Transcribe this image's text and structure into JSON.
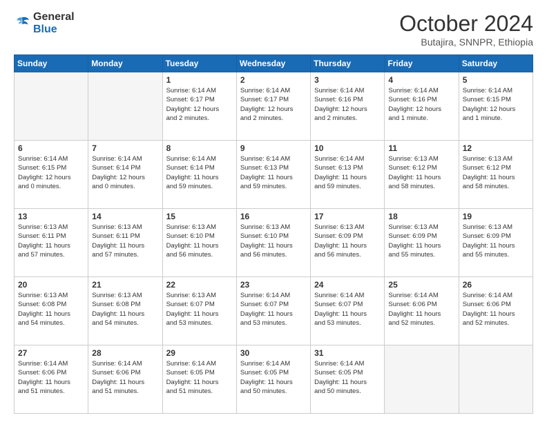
{
  "header": {
    "logo_general": "General",
    "logo_blue": "Blue",
    "title": "October 2024",
    "location": "Butajira, SNNPR, Ethiopia"
  },
  "days_of_week": [
    "Sunday",
    "Monday",
    "Tuesday",
    "Wednesday",
    "Thursday",
    "Friday",
    "Saturday"
  ],
  "weeks": [
    [
      {
        "day": "",
        "info": ""
      },
      {
        "day": "",
        "info": ""
      },
      {
        "day": "1",
        "info": "Sunrise: 6:14 AM\nSunset: 6:17 PM\nDaylight: 12 hours\nand 2 minutes."
      },
      {
        "day": "2",
        "info": "Sunrise: 6:14 AM\nSunset: 6:17 PM\nDaylight: 12 hours\nand 2 minutes."
      },
      {
        "day": "3",
        "info": "Sunrise: 6:14 AM\nSunset: 6:16 PM\nDaylight: 12 hours\nand 2 minutes."
      },
      {
        "day": "4",
        "info": "Sunrise: 6:14 AM\nSunset: 6:16 PM\nDaylight: 12 hours\nand 1 minute."
      },
      {
        "day": "5",
        "info": "Sunrise: 6:14 AM\nSunset: 6:15 PM\nDaylight: 12 hours\nand 1 minute."
      }
    ],
    [
      {
        "day": "6",
        "info": "Sunrise: 6:14 AM\nSunset: 6:15 PM\nDaylight: 12 hours\nand 0 minutes."
      },
      {
        "day": "7",
        "info": "Sunrise: 6:14 AM\nSunset: 6:14 PM\nDaylight: 12 hours\nand 0 minutes."
      },
      {
        "day": "8",
        "info": "Sunrise: 6:14 AM\nSunset: 6:14 PM\nDaylight: 11 hours\nand 59 minutes."
      },
      {
        "day": "9",
        "info": "Sunrise: 6:14 AM\nSunset: 6:13 PM\nDaylight: 11 hours\nand 59 minutes."
      },
      {
        "day": "10",
        "info": "Sunrise: 6:14 AM\nSunset: 6:13 PM\nDaylight: 11 hours\nand 59 minutes."
      },
      {
        "day": "11",
        "info": "Sunrise: 6:13 AM\nSunset: 6:12 PM\nDaylight: 11 hours\nand 58 minutes."
      },
      {
        "day": "12",
        "info": "Sunrise: 6:13 AM\nSunset: 6:12 PM\nDaylight: 11 hours\nand 58 minutes."
      }
    ],
    [
      {
        "day": "13",
        "info": "Sunrise: 6:13 AM\nSunset: 6:11 PM\nDaylight: 11 hours\nand 57 minutes."
      },
      {
        "day": "14",
        "info": "Sunrise: 6:13 AM\nSunset: 6:11 PM\nDaylight: 11 hours\nand 57 minutes."
      },
      {
        "day": "15",
        "info": "Sunrise: 6:13 AM\nSunset: 6:10 PM\nDaylight: 11 hours\nand 56 minutes."
      },
      {
        "day": "16",
        "info": "Sunrise: 6:13 AM\nSunset: 6:10 PM\nDaylight: 11 hours\nand 56 minutes."
      },
      {
        "day": "17",
        "info": "Sunrise: 6:13 AM\nSunset: 6:09 PM\nDaylight: 11 hours\nand 56 minutes."
      },
      {
        "day": "18",
        "info": "Sunrise: 6:13 AM\nSunset: 6:09 PM\nDaylight: 11 hours\nand 55 minutes."
      },
      {
        "day": "19",
        "info": "Sunrise: 6:13 AM\nSunset: 6:09 PM\nDaylight: 11 hours\nand 55 minutes."
      }
    ],
    [
      {
        "day": "20",
        "info": "Sunrise: 6:13 AM\nSunset: 6:08 PM\nDaylight: 11 hours\nand 54 minutes."
      },
      {
        "day": "21",
        "info": "Sunrise: 6:13 AM\nSunset: 6:08 PM\nDaylight: 11 hours\nand 54 minutes."
      },
      {
        "day": "22",
        "info": "Sunrise: 6:13 AM\nSunset: 6:07 PM\nDaylight: 11 hours\nand 53 minutes."
      },
      {
        "day": "23",
        "info": "Sunrise: 6:14 AM\nSunset: 6:07 PM\nDaylight: 11 hours\nand 53 minutes."
      },
      {
        "day": "24",
        "info": "Sunrise: 6:14 AM\nSunset: 6:07 PM\nDaylight: 11 hours\nand 53 minutes."
      },
      {
        "day": "25",
        "info": "Sunrise: 6:14 AM\nSunset: 6:06 PM\nDaylight: 11 hours\nand 52 minutes."
      },
      {
        "day": "26",
        "info": "Sunrise: 6:14 AM\nSunset: 6:06 PM\nDaylight: 11 hours\nand 52 minutes."
      }
    ],
    [
      {
        "day": "27",
        "info": "Sunrise: 6:14 AM\nSunset: 6:06 PM\nDaylight: 11 hours\nand 51 minutes."
      },
      {
        "day": "28",
        "info": "Sunrise: 6:14 AM\nSunset: 6:06 PM\nDaylight: 11 hours\nand 51 minutes."
      },
      {
        "day": "29",
        "info": "Sunrise: 6:14 AM\nSunset: 6:05 PM\nDaylight: 11 hours\nand 51 minutes."
      },
      {
        "day": "30",
        "info": "Sunrise: 6:14 AM\nSunset: 6:05 PM\nDaylight: 11 hours\nand 50 minutes."
      },
      {
        "day": "31",
        "info": "Sunrise: 6:14 AM\nSunset: 6:05 PM\nDaylight: 11 hours\nand 50 minutes."
      },
      {
        "day": "",
        "info": ""
      },
      {
        "day": "",
        "info": ""
      }
    ]
  ]
}
